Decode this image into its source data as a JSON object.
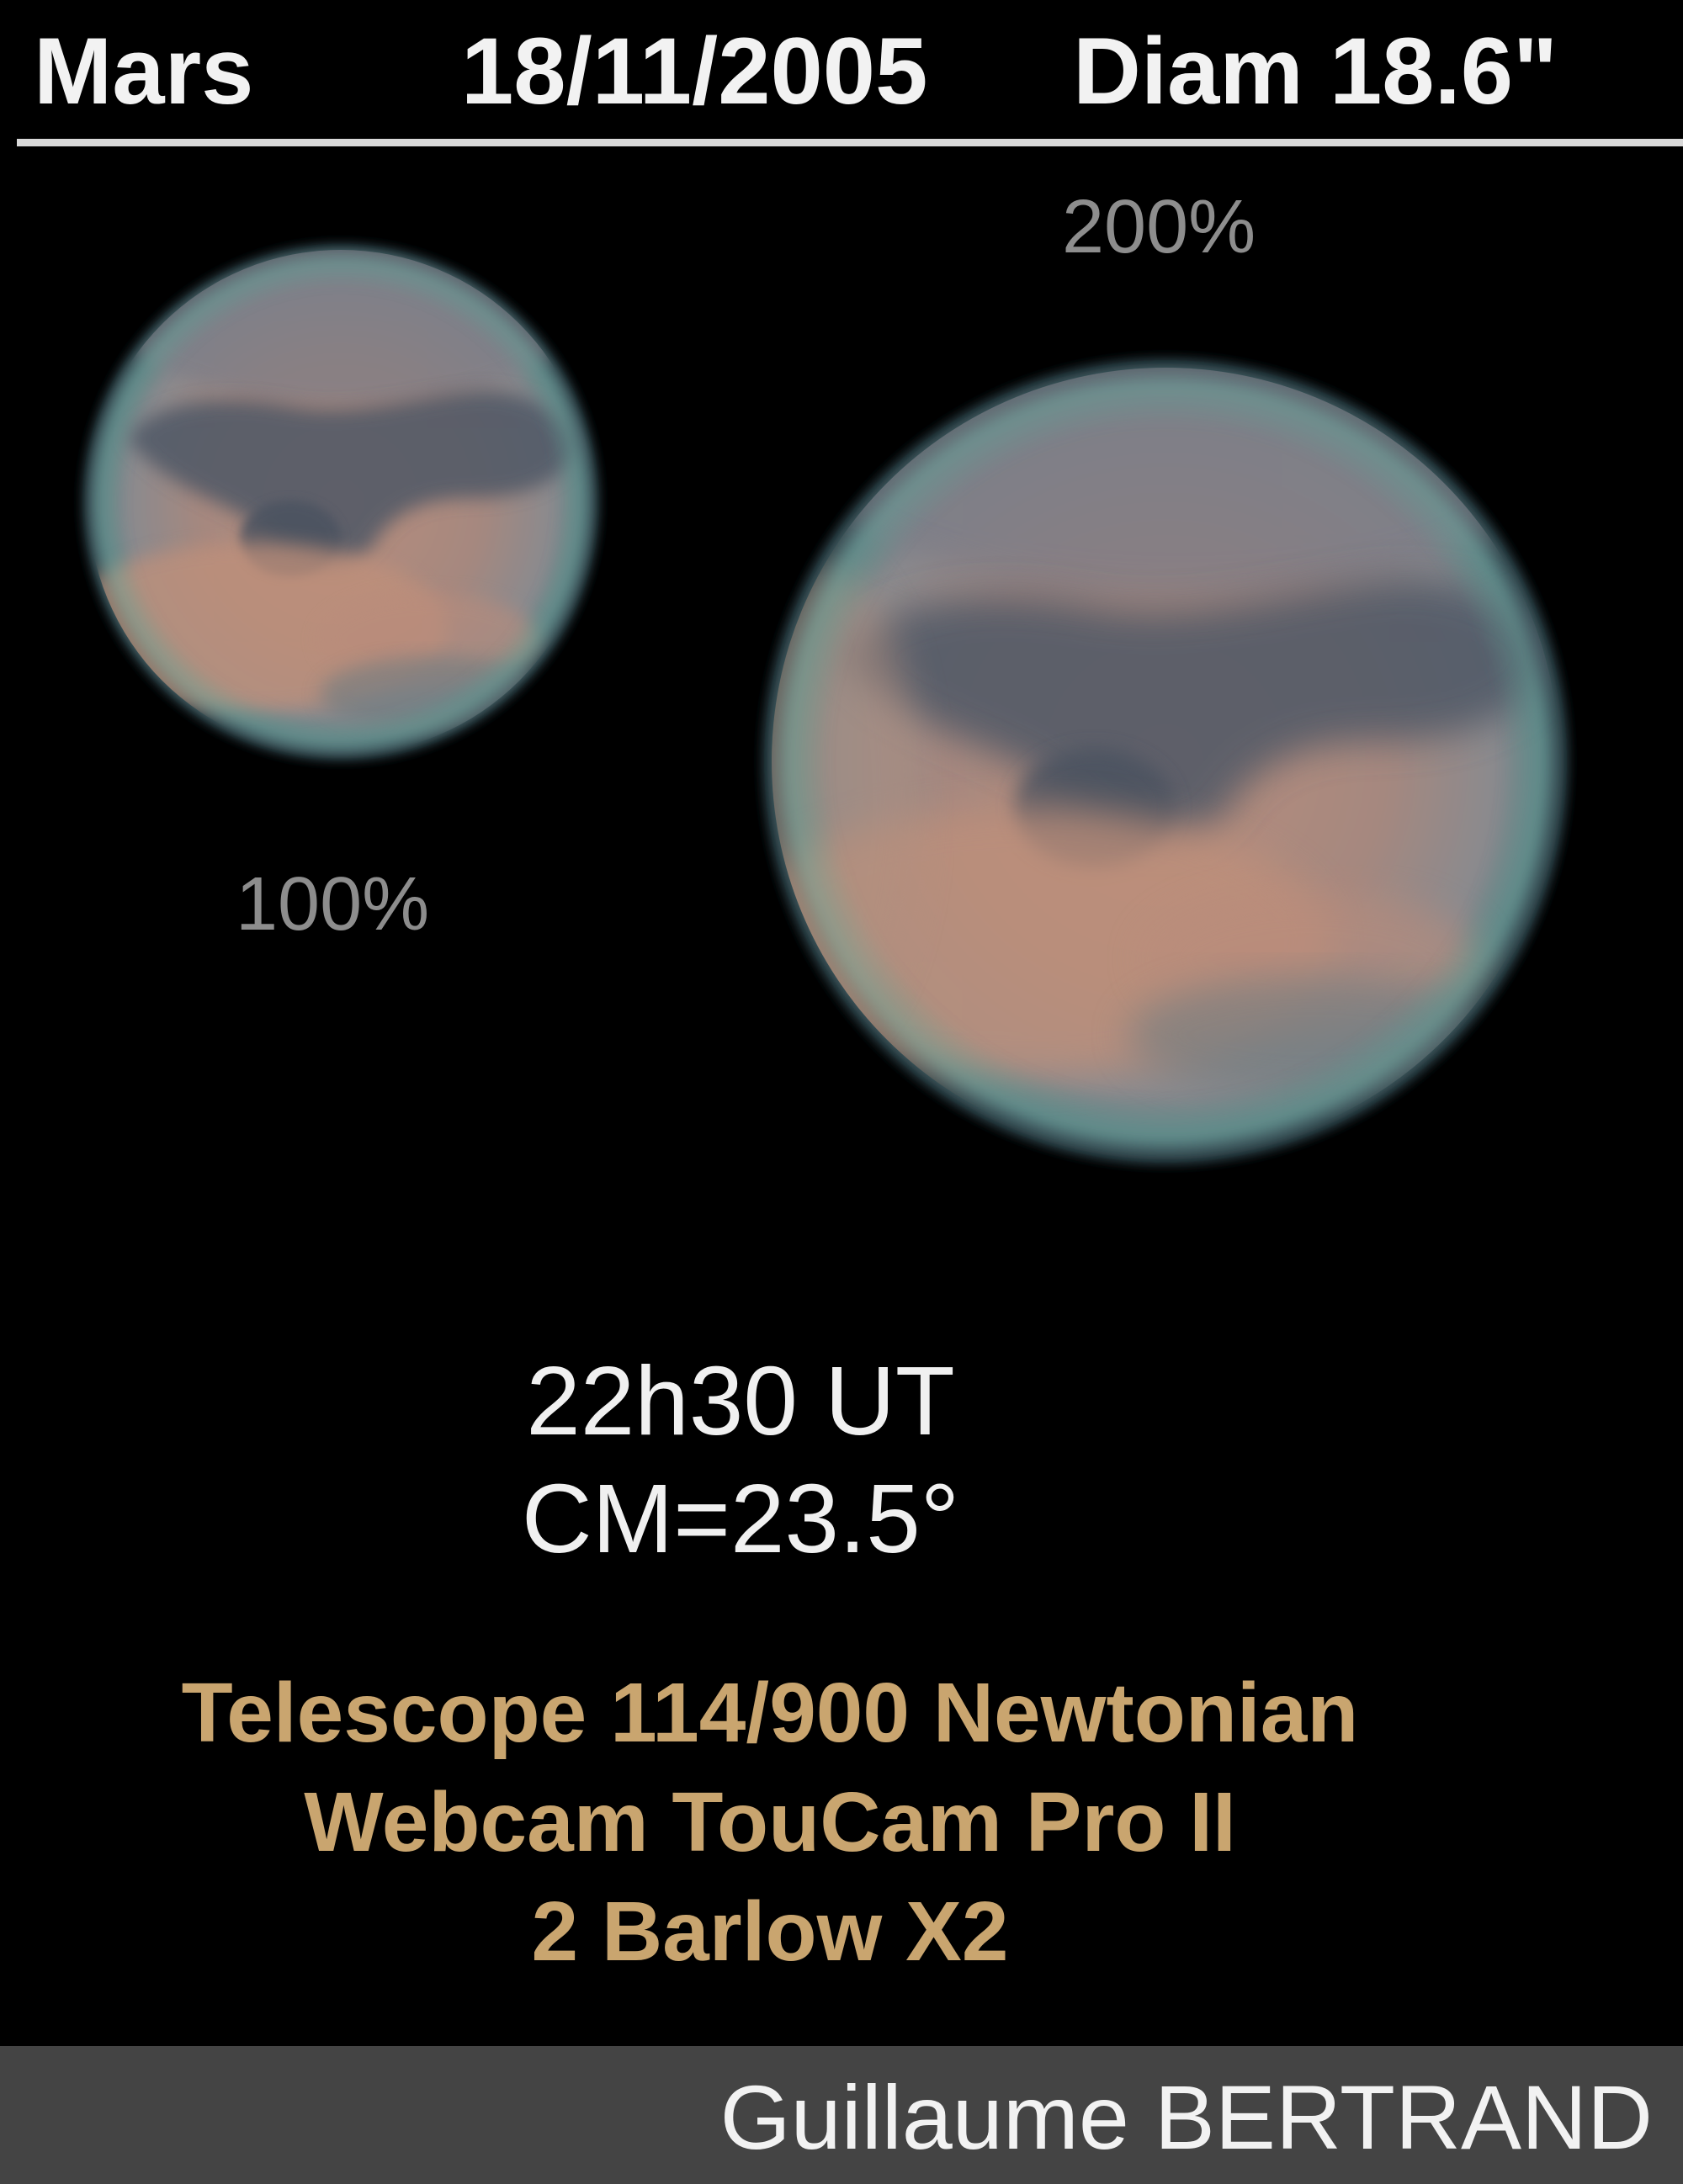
{
  "header": {
    "title": "Mars",
    "date": "18/11/2005",
    "diameter": "Diam 18.6\""
  },
  "images": {
    "small_label": "100%",
    "large_label": "200%"
  },
  "observation": {
    "time": "22h30 UT",
    "central_meridian": "CM=23.5°"
  },
  "equipment": {
    "telescope": "Telescope 114/900 Newtonian",
    "camera": "Webcam TouCam Pro II",
    "barlow": "2 Barlow X2"
  },
  "footer": {
    "author": "Guillaume BERTRAND"
  },
  "colors": {
    "background": "#000000",
    "header_text": "#f2f2f2",
    "zoom_label": "#8d8d8d",
    "equipment_text": "#c9a56f",
    "footer_bar": "#444444"
  }
}
